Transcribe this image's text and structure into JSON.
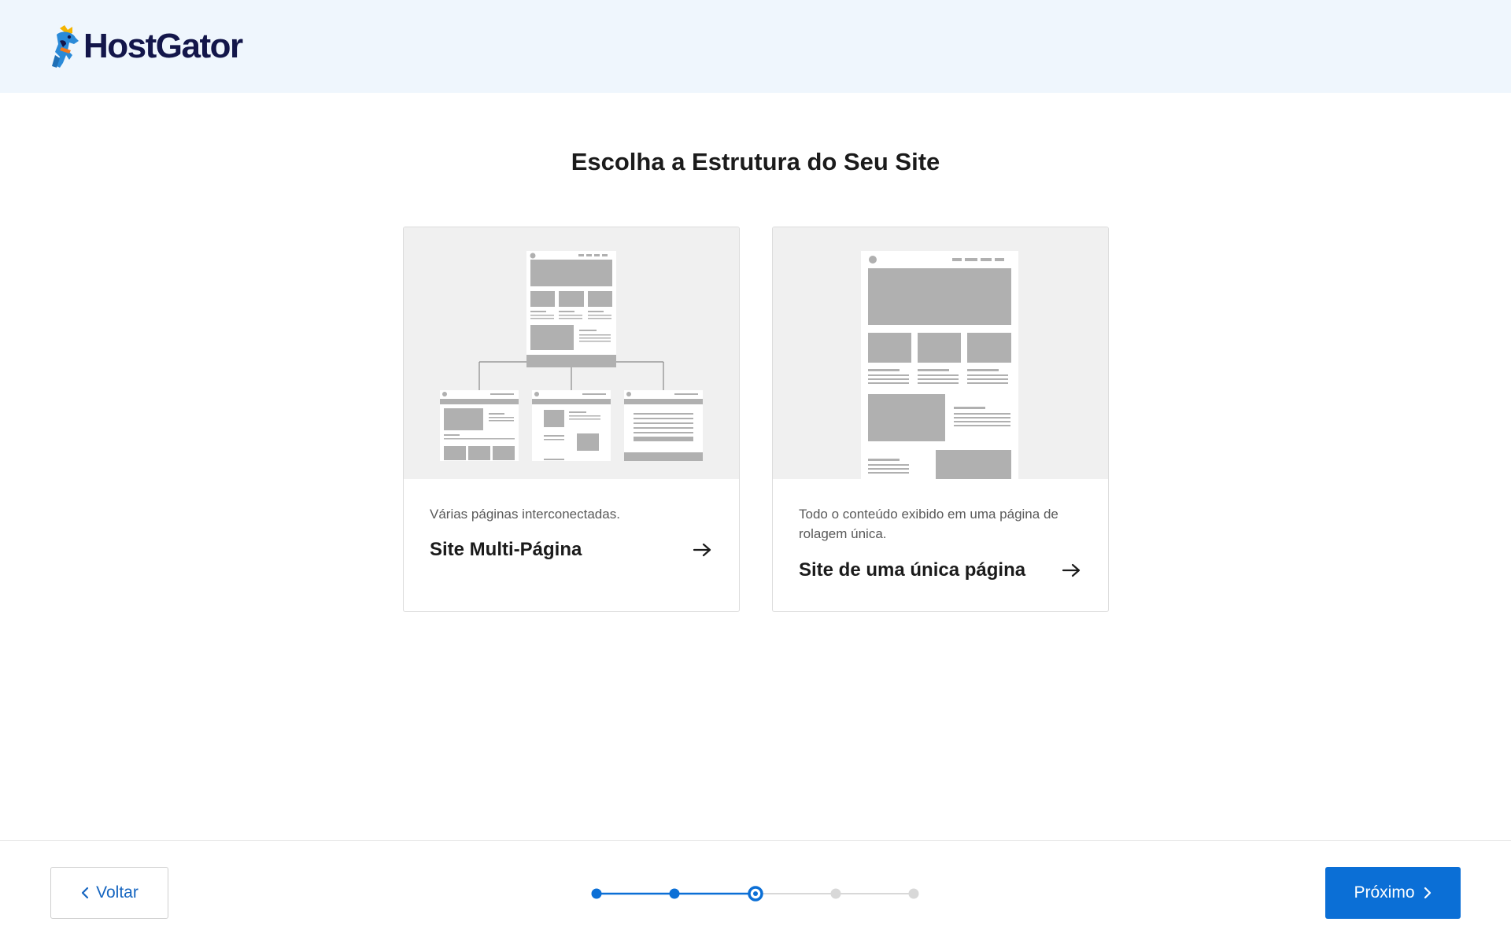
{
  "header": {
    "brand": "HostGator"
  },
  "page": {
    "title": "Escolha a Estrutura do Seu Site"
  },
  "cards": [
    {
      "description": "Várias páginas interconectadas.",
      "title": "Site Multi-Página"
    },
    {
      "description": "Todo o conteúdo exibido em uma página de rolagem única.",
      "title": "Site de uma única página"
    }
  ],
  "footer": {
    "back_label": "Voltar",
    "next_label": "Próximo",
    "progress": {
      "total_steps": 5,
      "current_step": 3
    }
  },
  "colors": {
    "accent": "#0b6fd6",
    "header_bg": "#eff6fd",
    "brand_text": "#13164a",
    "inactive": "#d8d8d8"
  },
  "icons": [
    "hostgator-mascot-icon",
    "arrow-right-icon",
    "chevron-left-icon",
    "chevron-right-icon"
  ]
}
